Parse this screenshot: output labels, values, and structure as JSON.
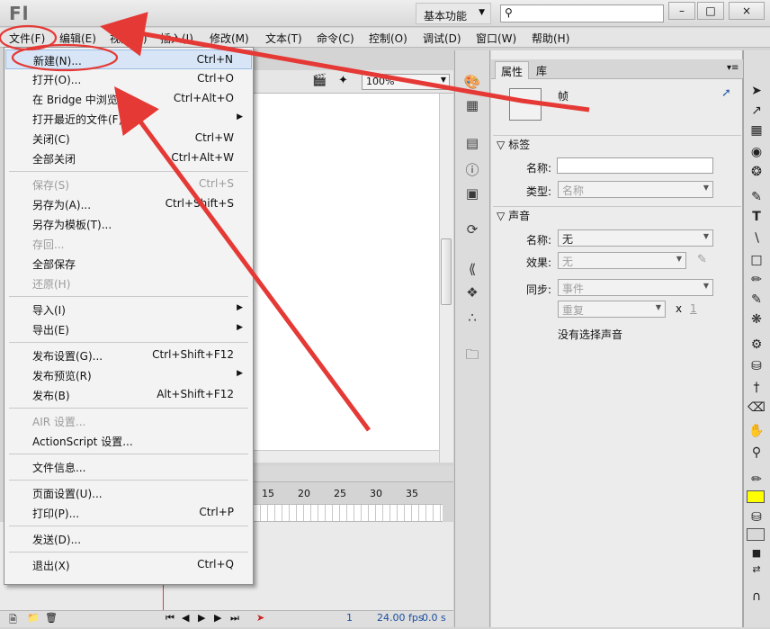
{
  "app": {
    "logo": "Fl",
    "workspace": "基本功能",
    "search_icon": "search-icon",
    "window_buttons": [
      "–",
      "□",
      "×"
    ]
  },
  "menubar": [
    "文件(F)",
    "编辑(E)",
    "视图(V)",
    "插入(I)",
    "修改(M)",
    "文本(T)",
    "命令(C)",
    "控制(O)",
    "调试(D)",
    "窗口(W)",
    "帮助(H)"
  ],
  "file_menu": [
    {
      "label": "新建(N)...",
      "shortcut": "Ctrl+N",
      "state": "highlighted"
    },
    {
      "label": "打开(O)...",
      "shortcut": "Ctrl+O"
    },
    {
      "label": "在 Bridge 中浏览",
      "shortcut": "Ctrl+Alt+O"
    },
    {
      "label": "打开最近的文件(F)",
      "shortcut": "",
      "submenu": true
    },
    {
      "label": "关闭(C)",
      "shortcut": "Ctrl+W"
    },
    {
      "label": "全部关闭",
      "shortcut": "Ctrl+Alt+W"
    },
    {
      "separator": true
    },
    {
      "label": "保存(S)",
      "shortcut": "Ctrl+S",
      "state": "disabled"
    },
    {
      "label": "另存为(A)...",
      "shortcut": "Ctrl+Shift+S"
    },
    {
      "label": "另存为模板(T)...",
      "shortcut": ""
    },
    {
      "label": "存回...",
      "shortcut": "",
      "state": "disabled"
    },
    {
      "label": "全部保存",
      "shortcut": ""
    },
    {
      "label": "还原(H)",
      "shortcut": "",
      "state": "disabled"
    },
    {
      "separator": true
    },
    {
      "label": "导入(I)",
      "shortcut": "",
      "submenu": true
    },
    {
      "label": "导出(E)",
      "shortcut": "",
      "submenu": true
    },
    {
      "separator": true
    },
    {
      "label": "发布设置(G)...",
      "shortcut": "Ctrl+Shift+F12"
    },
    {
      "label": "发布预览(R)",
      "shortcut": "",
      "submenu": true
    },
    {
      "label": "发布(B)",
      "shortcut": "Alt+Shift+F12"
    },
    {
      "separator": true
    },
    {
      "label": "AIR 设置...",
      "shortcut": "",
      "state": "disabled"
    },
    {
      "label": "ActionScript 设置...",
      "shortcut": ""
    },
    {
      "separator": true
    },
    {
      "label": "文件信息...",
      "shortcut": ""
    },
    {
      "separator": true
    },
    {
      "label": "页面设置(U)...",
      "shortcut": ""
    },
    {
      "label": "打印(P)...",
      "shortcut": "Ctrl+P"
    },
    {
      "separator": true
    },
    {
      "label": "发送(D)...",
      "shortcut": ""
    },
    {
      "separator": true
    },
    {
      "label": "退出(X)",
      "shortcut": "Ctrl+Q"
    }
  ],
  "stage": {
    "zoom": "100%"
  },
  "timeline": {
    "frame_numbers": [
      "15",
      "20",
      "25",
      "30",
      "35"
    ],
    "current_frame": "1",
    "fps": "24.00 fps",
    "time": "0.0 s"
  },
  "properties": {
    "tabs": [
      "属性",
      "库"
    ],
    "frame_label": "帧",
    "section_label": "标签",
    "name_label": "名称:",
    "name_value": "",
    "type_label": "类型:",
    "type_value": "名称",
    "section_sound": "声音",
    "sound_name_label": "名称:",
    "sound_name_value": "无",
    "effect_label": "效果:",
    "effect_value": "无",
    "sync_label": "同步:",
    "sync_value": "事件",
    "repeat_value": "重复",
    "repeat_x": "x",
    "repeat_count": "1",
    "no_sound": "没有选择声音"
  },
  "colors": {
    "stroke_swatch": "#ffff00",
    "annotation": "#e53935",
    "highlight": "#d7e5f6"
  }
}
